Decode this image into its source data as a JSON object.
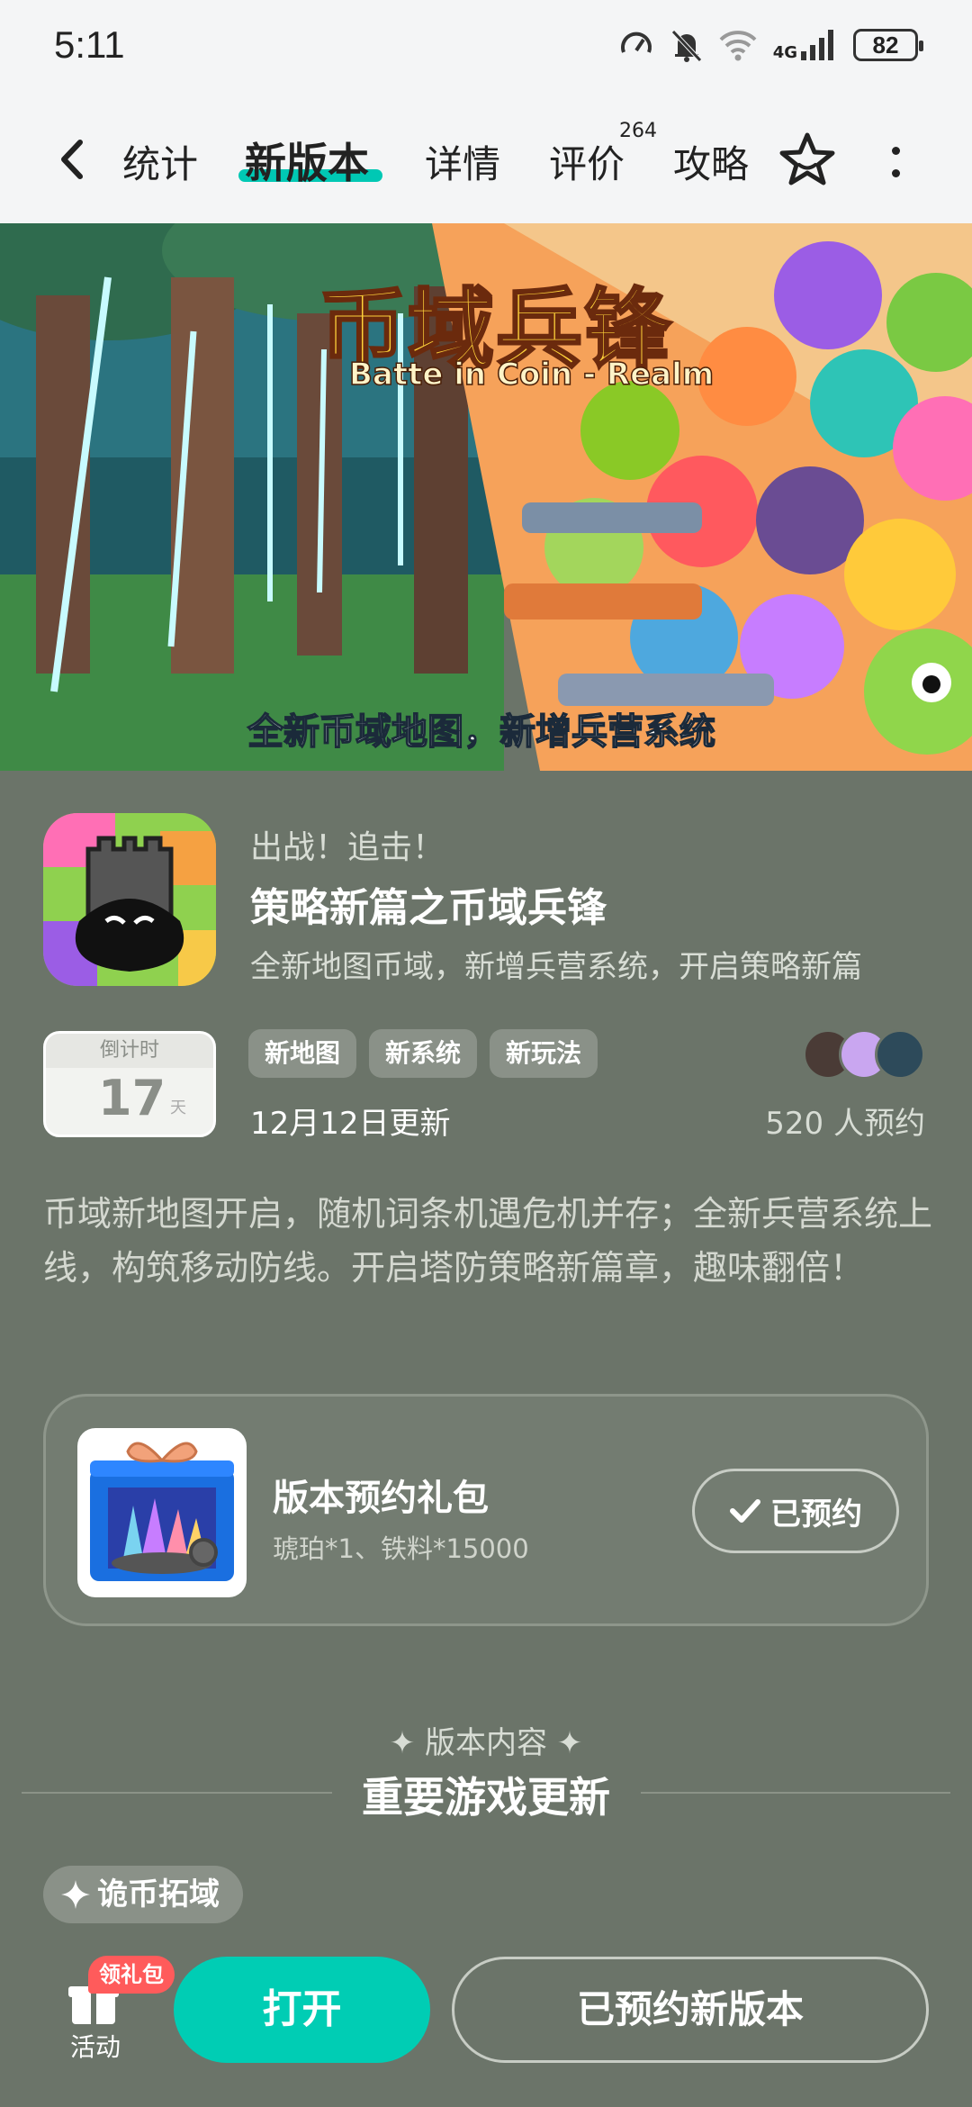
{
  "status_bar": {
    "time": "5:11",
    "network": "4G",
    "battery": "82"
  },
  "nav": {
    "tabs": [
      {
        "label": "统计"
      },
      {
        "label": "新版本"
      },
      {
        "label": "详情"
      },
      {
        "label": "评价"
      },
      {
        "label": "攻略"
      }
    ],
    "reviews_badge": "264"
  },
  "banner": {
    "title": "币域兵锋",
    "subtitle": "Batte in Coin - Realm",
    "caption": "全新币域地图，新增兵营系统"
  },
  "update": {
    "kicker": "出战！追击！",
    "headline": "策略新篇之币域兵锋",
    "subline": "全新地图币域，新增兵营系统，开启策略新篇",
    "countdown_label": "倒计时",
    "countdown_value": "17",
    "countdown_unit": "天",
    "tags": [
      "新地图",
      "新系统",
      "新玩法"
    ],
    "date": "12月12日更新",
    "reserve_count": "520 人预约",
    "description": "币域新地图开启，随机词条机遇危机并存；全新兵营系统上线，构筑移动防线。开启塔防策略新篇章，趣味翻倍！"
  },
  "gift": {
    "title": "版本预约礼包",
    "items": "琥珀*1、铁料*15000",
    "button": "已预约"
  },
  "section": {
    "kicker": "✦ 版本内容 ✦",
    "title": "重要游戏更新",
    "chip": "诡币拓域"
  },
  "bottom": {
    "activity_label": "活动",
    "gift_badge": "领礼包",
    "open_button": "打开",
    "version_button": "已预约新版本"
  },
  "colors": {
    "accent": "#00cdb4",
    "page_bg": "#6b7469",
    "badge_red": "#ff5b5b"
  }
}
